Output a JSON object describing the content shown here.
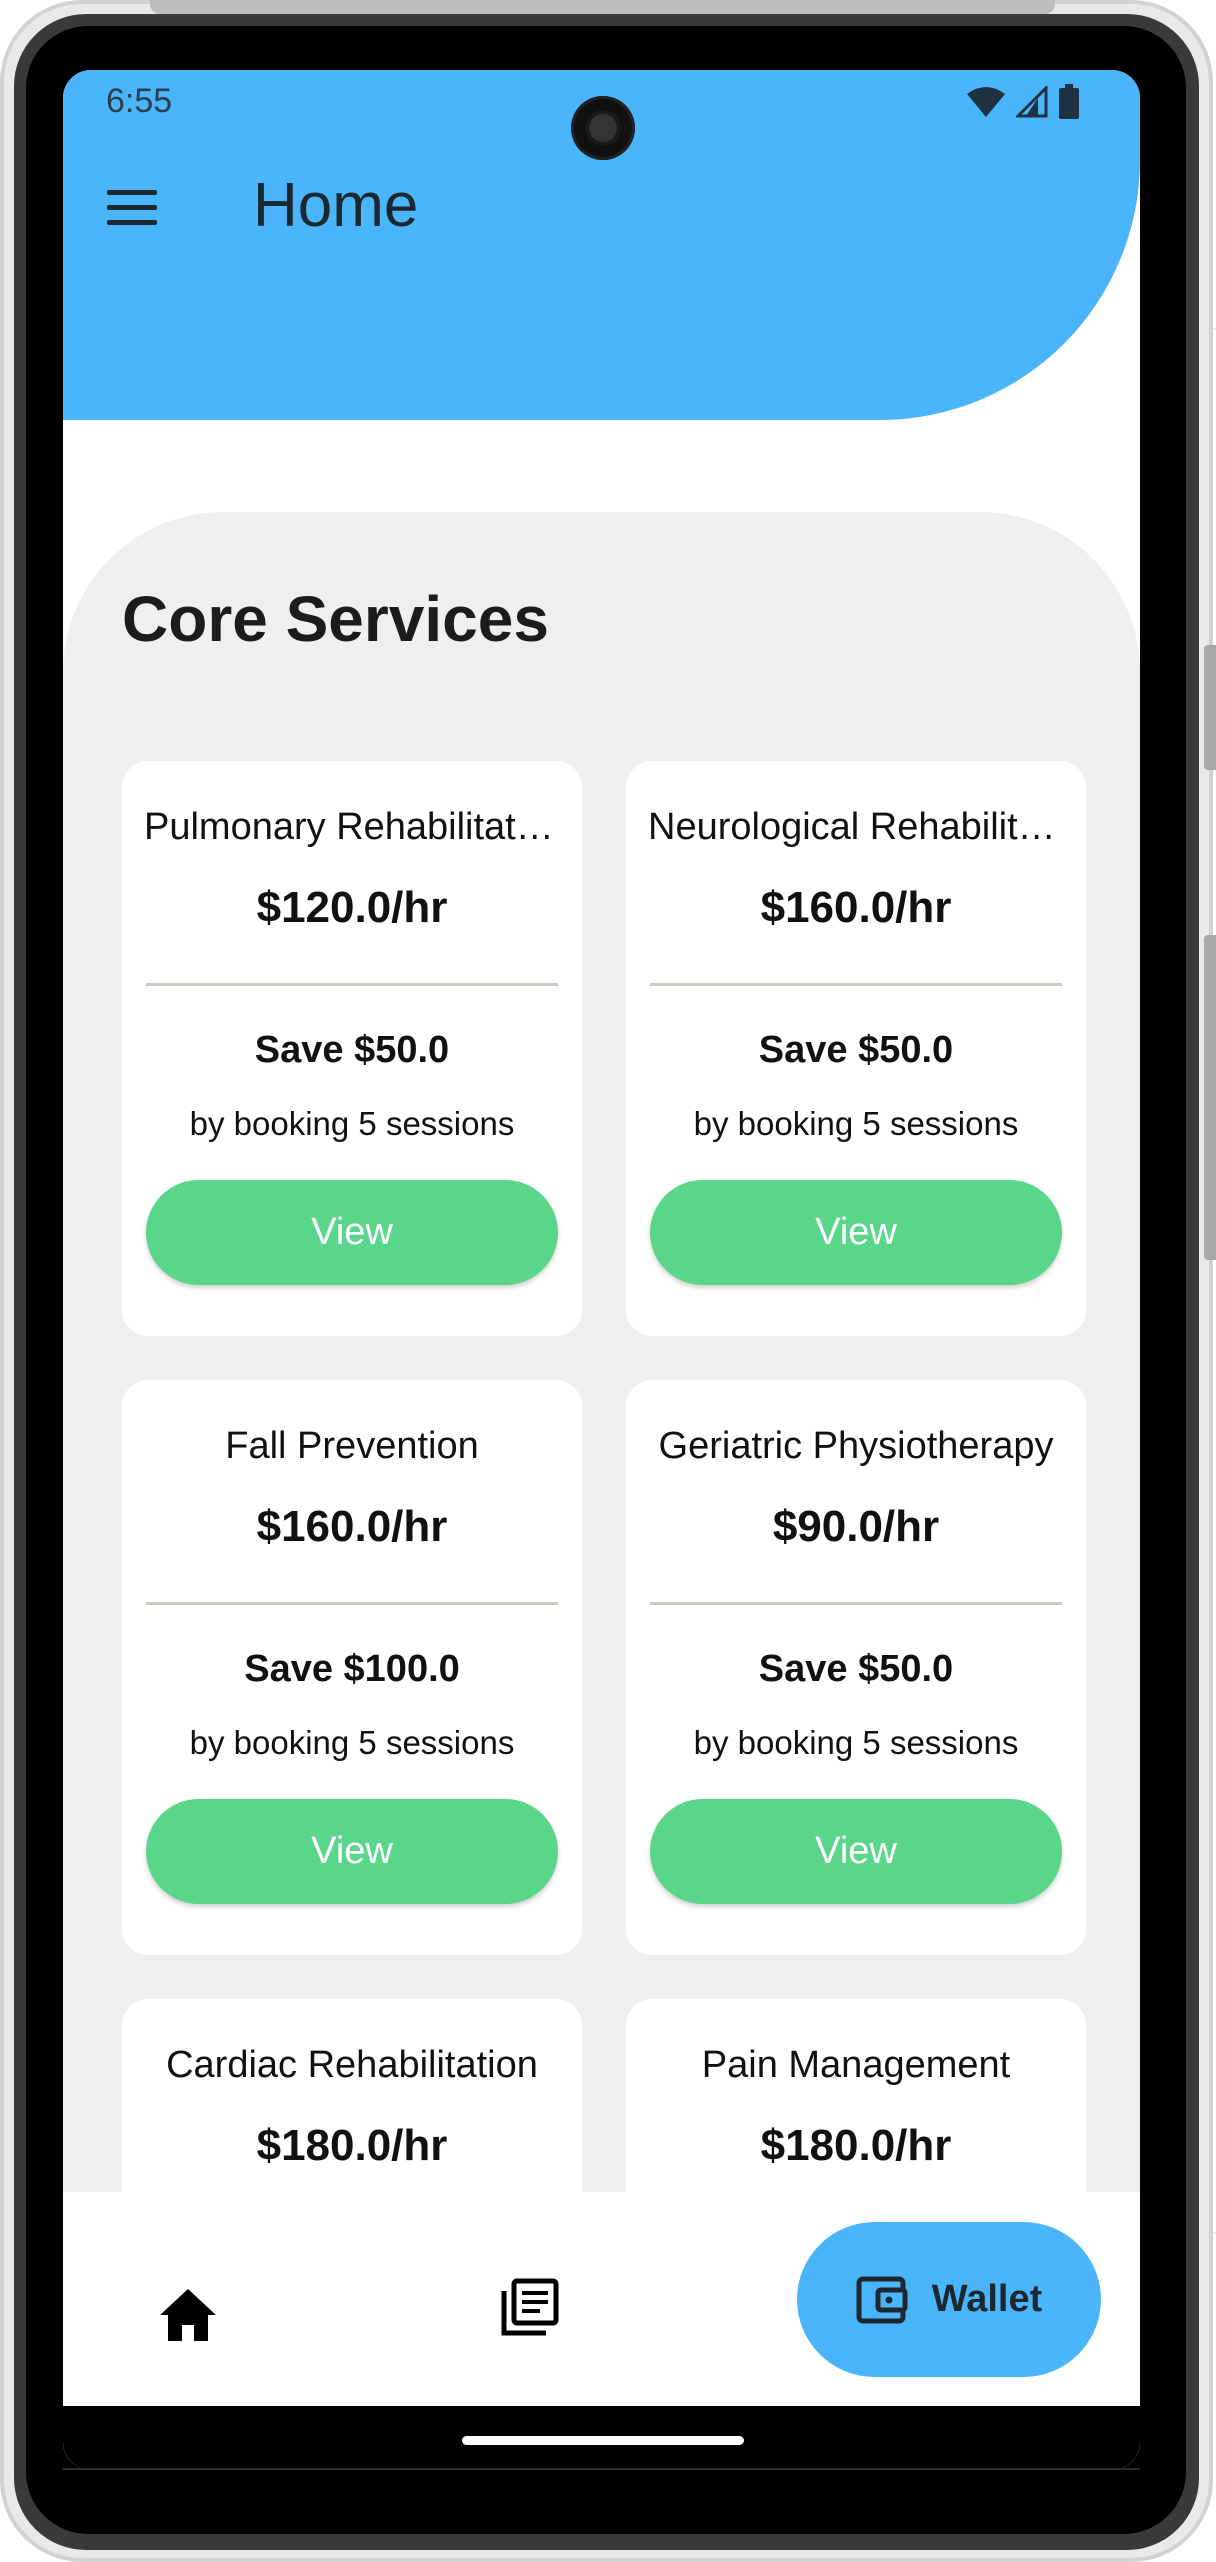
{
  "status_bar": {
    "time": "6:55",
    "icons": [
      "wifi-icon",
      "signal-icon",
      "battery-icon"
    ]
  },
  "header": {
    "title": "Home",
    "color": "#4ab5fb"
  },
  "core_services": {
    "title": "Core Services",
    "cards": [
      {
        "name": "Pulmonary Rehabilitation",
        "price": "$120.0/hr",
        "save": "Save $50.0",
        "note": "by booking 5 sessions",
        "button": "View"
      },
      {
        "name": "Neurological Rehabilitation",
        "price": "$160.0/hr",
        "save": "Save $50.0",
        "note": "by booking 5 sessions",
        "button": "View"
      },
      {
        "name": "Fall Prevention",
        "price": "$160.0/hr",
        "save": "Save $100.0",
        "note": "by booking 5 sessions",
        "button": "View"
      },
      {
        "name": "Geriatric Physiotherapy",
        "price": "$90.0/hr",
        "save": "Save $50.0",
        "note": "by booking 5 sessions",
        "button": "View"
      },
      {
        "name": "Cardiac Rehabilitation",
        "price": "$180.0/hr",
        "save": "",
        "note": "",
        "button": ""
      },
      {
        "name": "Pain Management",
        "price": "$180.0/hr",
        "save": "",
        "note": "",
        "button": ""
      }
    ],
    "button_color": "#5ad68a"
  },
  "bottom_nav": {
    "items": [
      {
        "icon": "home-icon",
        "label": ""
      },
      {
        "icon": "orders-icon",
        "label": ""
      },
      {
        "icon": "wallet-icon",
        "label": "Wallet",
        "active": true
      }
    ]
  }
}
